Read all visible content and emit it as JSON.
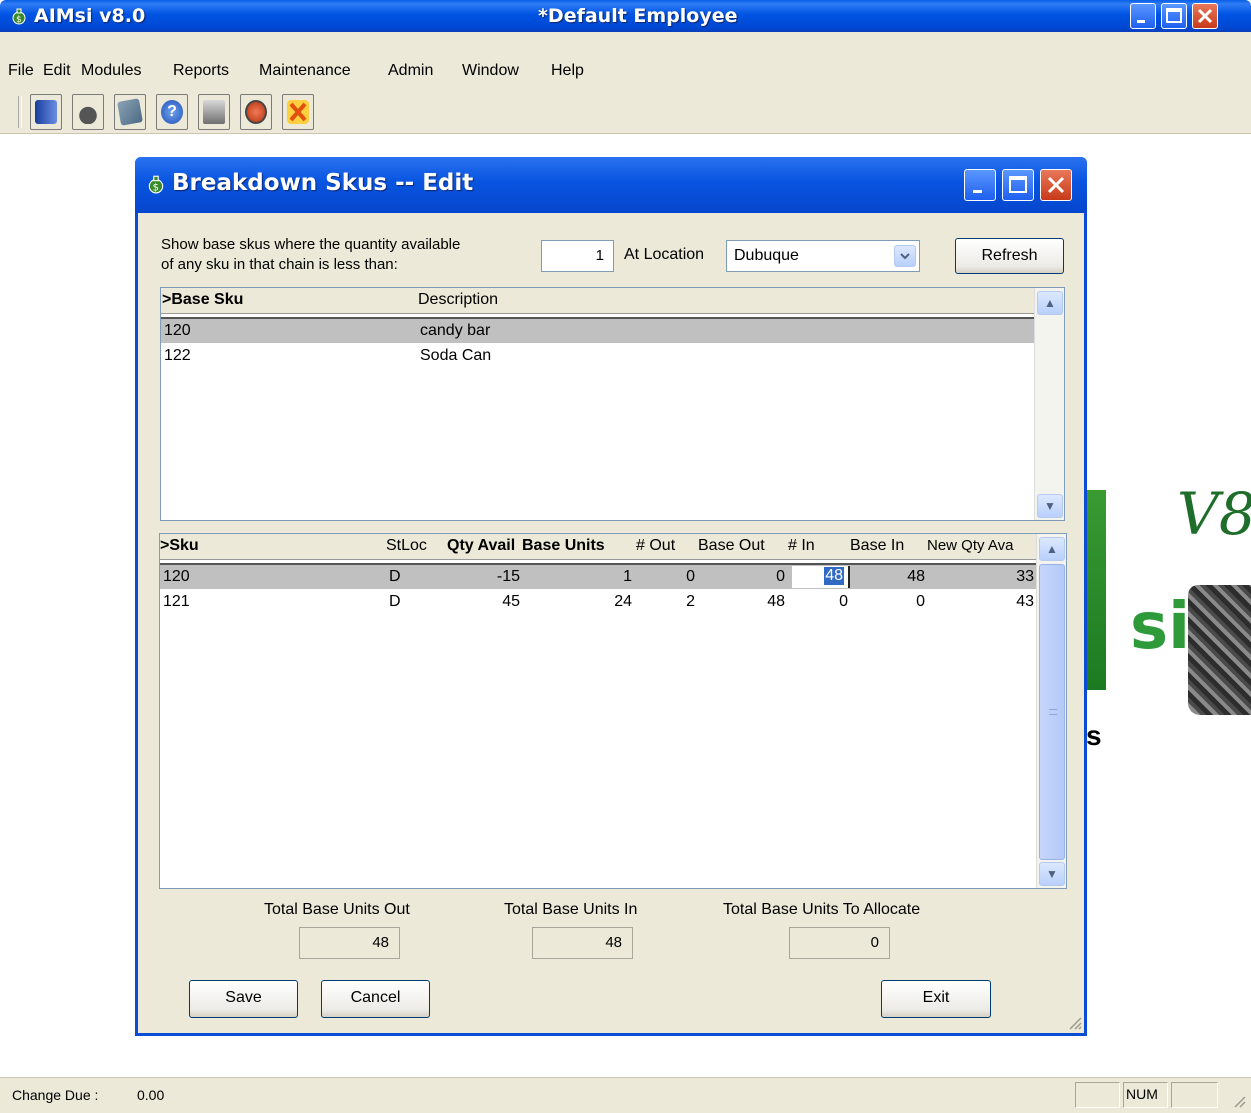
{
  "window": {
    "app_title": "AIMsi v8.0",
    "document_title": "*Default Employee"
  },
  "menu": {
    "items": [
      "File",
      "Edit",
      "Modules",
      "Reports",
      "Maintenance",
      "Admin",
      "Window",
      "Help"
    ]
  },
  "toolbar": {
    "icons": [
      "document-icon",
      "cashier-icon",
      "calculator-icon",
      "help-icon",
      "printer-icon",
      "stop-icon",
      "exit-icon"
    ]
  },
  "dialog": {
    "title": "Breakdown Skus -- Edit",
    "filter_label_line1": "Show base skus where the quantity available",
    "filter_label_line2": "of any sku in that chain is less than:",
    "quantity_value": "1",
    "location_label": "At Location",
    "location_value": "Dubuque",
    "refresh_label": "Refresh",
    "base_grid": {
      "headers": [
        ">Base Sku",
        "Description"
      ],
      "rows": [
        {
          "sku": "120",
          "description": "candy bar",
          "selected": true
        },
        {
          "sku": "122",
          "description": "Soda Can",
          "selected": false
        }
      ]
    },
    "sku_grid": {
      "headers": [
        ">Sku",
        "StLoc",
        "Qty Avail",
        "Base Units",
        "# Out",
        "Base Out",
        "# In",
        "Base In",
        "New Qty Ava"
      ],
      "rows": [
        {
          "sku": "120",
          "stloc": "D",
          "qty_avail": "-15",
          "base_units": "1",
          "num_out": "0",
          "base_out": "0",
          "num_in": "48",
          "base_in": "48",
          "new_qty": "33",
          "selected": true
        },
        {
          "sku": "121",
          "stloc": "D",
          "qty_avail": "45",
          "base_units": "24",
          "num_out": "2",
          "base_out": "48",
          "num_in": "0",
          "base_in": "0",
          "new_qty": "43",
          "selected": false
        }
      ]
    },
    "totals": {
      "out_label": "Total Base Units Out",
      "out_value": "48",
      "in_label": "Total Base Units In",
      "in_value": "48",
      "allocate_label": "Total Base Units To Allocate",
      "allocate_value": "0"
    },
    "buttons": {
      "save": "Save",
      "cancel": "Cancel",
      "exit": "Exit"
    }
  },
  "status": {
    "change_due_label": "Change Due :",
    "change_due_value": "0.00",
    "num_indicator": "NUM"
  },
  "logo": {
    "v8_text": "V8",
    "si_text": "si",
    "s_text": "s"
  },
  "colors": {
    "title_blue": "#0054e3",
    "dialog_bg": "#ece9d8",
    "selected_row": "#c0c0c0",
    "logo_green": "#2e9a3a"
  }
}
